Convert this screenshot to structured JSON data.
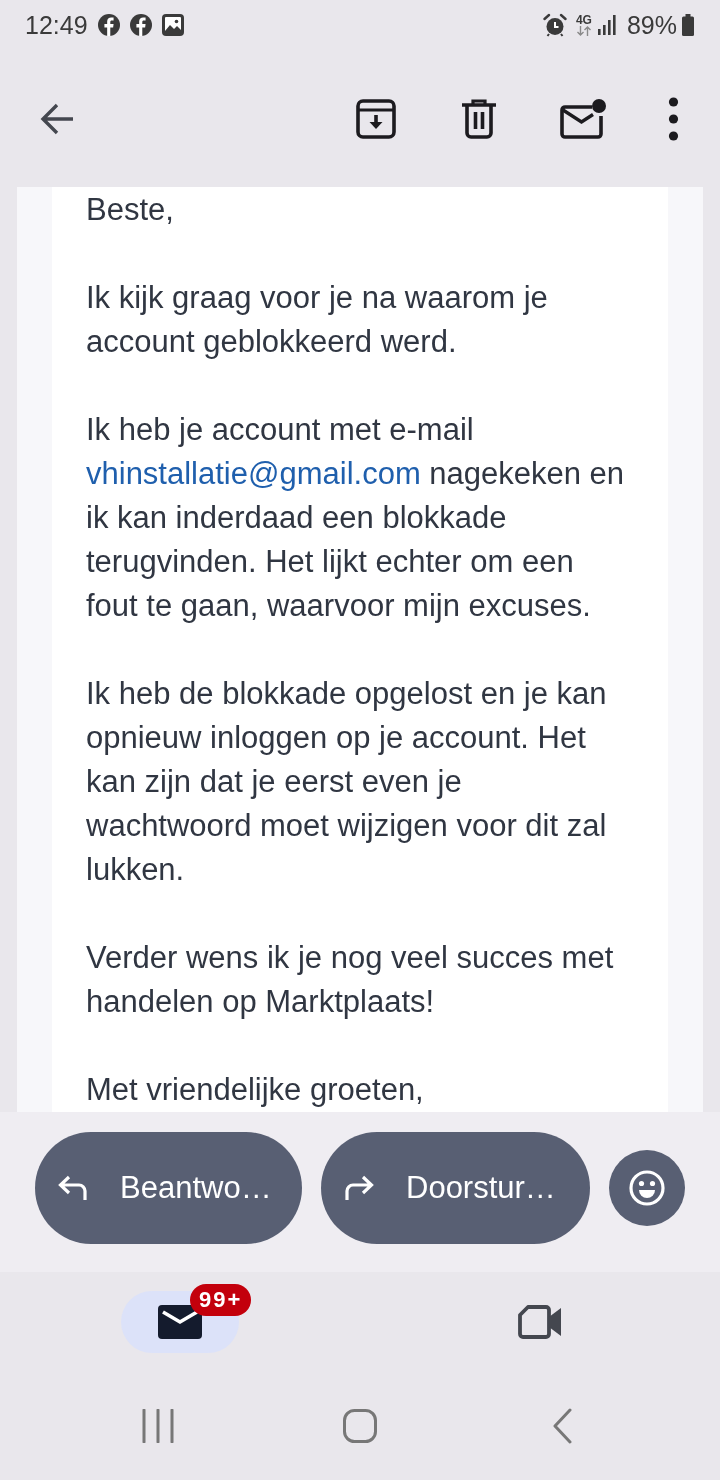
{
  "status_bar": {
    "time": "12:49",
    "network": "4G",
    "battery": "89%"
  },
  "email": {
    "paragraphs": [
      {
        "segments": [
          {
            "kind": "text",
            "text": "Beste,"
          }
        ]
      },
      {
        "segments": [
          {
            "kind": "text",
            "text": "Ik kijk graag voor je na waarom je account geblokkeerd werd."
          }
        ]
      },
      {
        "segments": [
          {
            "kind": "text",
            "text": "Ik heb je account met e-mail "
          },
          {
            "kind": "link",
            "text": "vhinstallatie@gmail.com"
          },
          {
            "kind": "text",
            "text": " nagekeken en ik kan inderdaad een blokkade terugvinden. Het lijkt echter om een fout te gaan, waarvoor mijn excuses."
          }
        ]
      },
      {
        "segments": [
          {
            "kind": "text",
            "text": "Ik heb de blokkade opgelost en je kan opnieuw inloggen op je account. Het kan zijn dat je eerst even je wachtwoord moet wijzigen voor dit zal lukken."
          }
        ]
      },
      {
        "segments": [
          {
            "kind": "text",
            "text": "Verder wens ik je nog veel succes met handelen op Marktplaats!"
          }
        ]
      },
      {
        "segments": [
          {
            "kind": "text",
            "text": "Met vriendelijke groeten,"
          }
        ]
      }
    ]
  },
  "actions": [
    {
      "kind": "reply",
      "label": "Beantwo…"
    },
    {
      "kind": "forward",
      "label": "Doorstur…"
    }
  ],
  "bottom_nav": [
    {
      "kind": "mail",
      "selected": true,
      "badge": "99+"
    },
    {
      "kind": "video",
      "selected": false
    }
  ]
}
